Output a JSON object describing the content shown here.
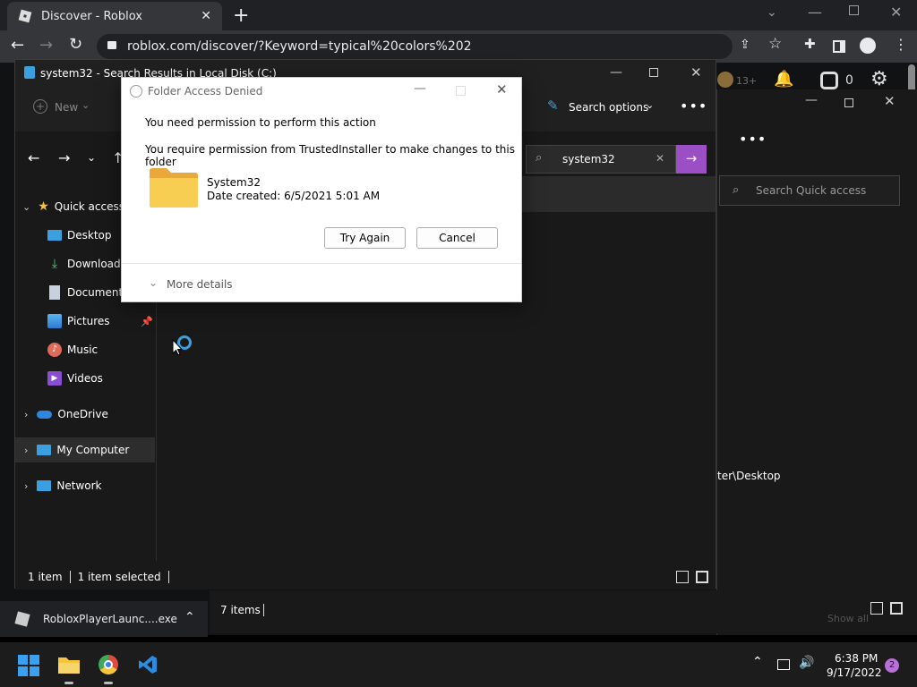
{
  "browser": {
    "tab_title": "Discover - Roblox",
    "url": "roblox.com/discover/?Keyword=typical%20colors%202",
    "roblox_badge": "13+",
    "robux": "0"
  },
  "explorer": {
    "title": "system32 - Search Results in Local Disk (C:)",
    "new_label": "New",
    "search_options_label": "Search options",
    "search_value": "system32",
    "sidebar": {
      "quick_access": "Quick access",
      "items": [
        "Desktop",
        "Downloads",
        "Documents",
        "Pictures",
        "Music",
        "Videos"
      ],
      "onedrive": "OneDrive",
      "my_computer": "My Computer",
      "network": "Network"
    },
    "status": {
      "count": "1 item",
      "selected": "1 item selected"
    }
  },
  "explorer2": {
    "search_placeholder": "Search Quick access",
    "path_fragment": "ter\\Desktop",
    "status_count": "7 items",
    "show_all": "Show all"
  },
  "dialog": {
    "title": "Folder Access Denied",
    "heading": "You need permission to perform this action",
    "message": "You require permission from TrustedInstaller to make changes to this folder",
    "folder_name": "System32",
    "date_created": "Date created: 6/5/2021 5:01 AM",
    "try_again": "Try Again",
    "cancel": "Cancel",
    "more_details": "More details"
  },
  "download_bar": {
    "file": "RobloxPlayerLaunc....exe"
  },
  "taskbar": {
    "time": "6:38 PM",
    "date": "9/17/2022",
    "notifications": "2"
  },
  "colors": {
    "accent": "#0078d4",
    "search_go": "#9b4fc4",
    "folder": "#f5c53d"
  }
}
